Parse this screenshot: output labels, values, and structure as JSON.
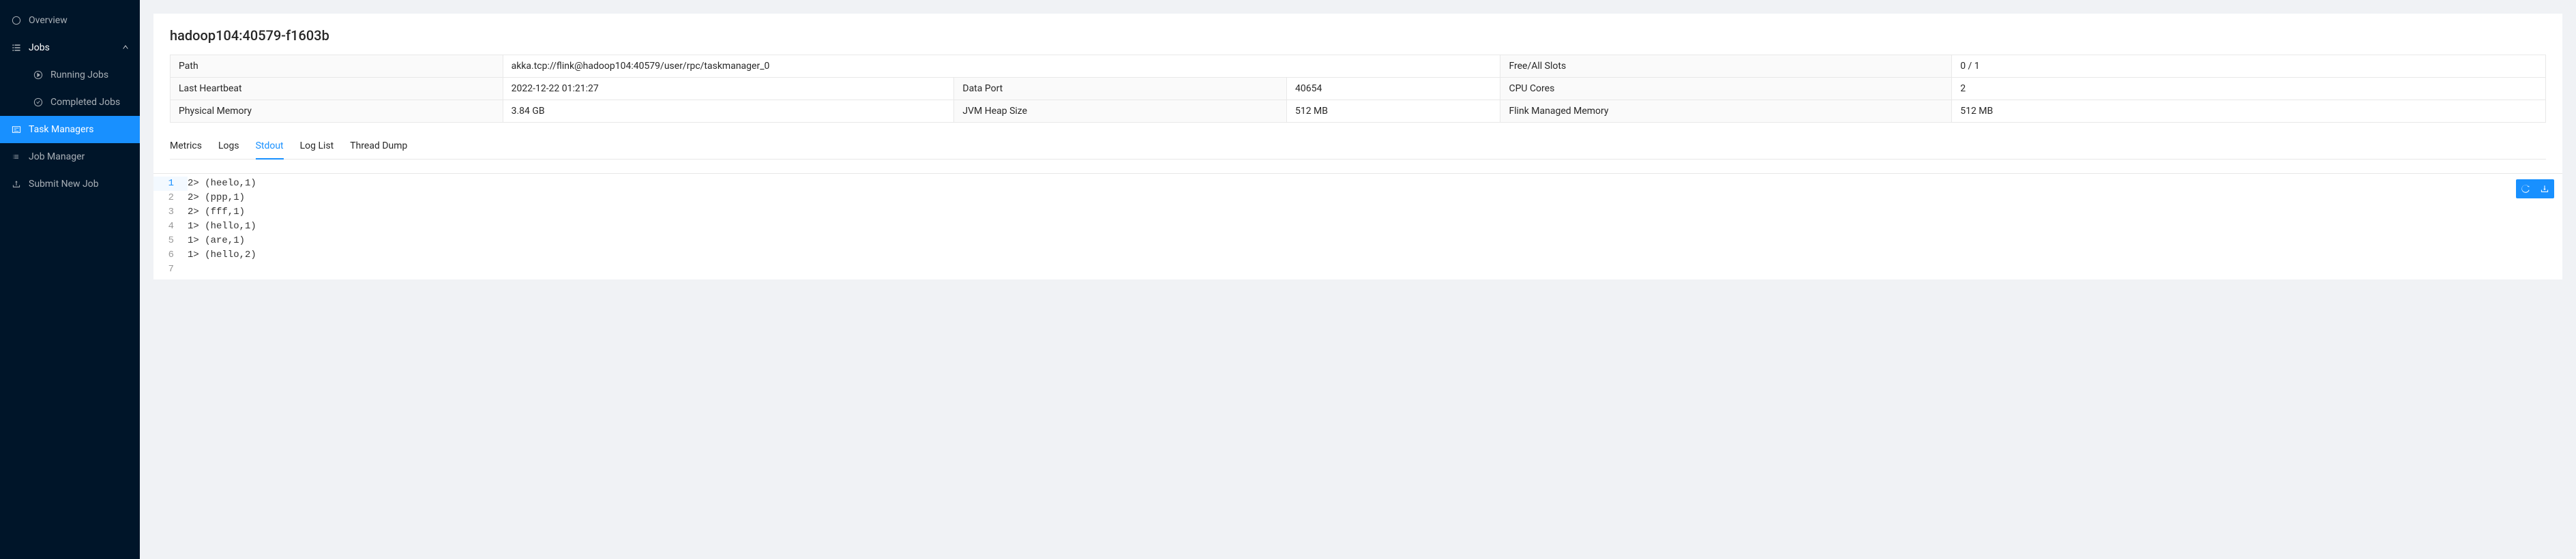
{
  "sidebar": {
    "items": [
      {
        "label": "Overview",
        "icon": "dashboard"
      },
      {
        "label": "Jobs",
        "icon": "list",
        "expanded": true
      },
      {
        "label": "Task Managers",
        "icon": "schedule",
        "active": true
      },
      {
        "label": "Job Manager",
        "icon": "bars"
      },
      {
        "label": "Submit New Job",
        "icon": "upload"
      }
    ],
    "submenu": [
      {
        "label": "Running Jobs",
        "icon": "play-circle"
      },
      {
        "label": "Completed Jobs",
        "icon": "check-circle"
      }
    ]
  },
  "header": {
    "title": "hadoop104:40579-f1603b"
  },
  "info": {
    "path_label": "Path",
    "path_value": "akka.tcp://flink@hadoop104:40579/user/rpc/taskmanager_0",
    "slots_label": "Free/All Slots",
    "slots_value": "0 / 1",
    "heartbeat_label": "Last Heartbeat",
    "heartbeat_value": "2022-12-22 01:21:27",
    "dataport_label": "Data Port",
    "dataport_value": "40654",
    "cpu_label": "CPU Cores",
    "cpu_value": "2",
    "physmem_label": "Physical Memory",
    "physmem_value": "3.84 GB",
    "heap_label": "JVM Heap Size",
    "heap_value": "512 MB",
    "managed_label": "Flink Managed Memory",
    "managed_value": "512 MB"
  },
  "tabs": [
    {
      "label": "Metrics"
    },
    {
      "label": "Logs"
    },
    {
      "label": "Stdout",
      "active": true
    },
    {
      "label": "Log List"
    },
    {
      "label": "Thread Dump"
    }
  ],
  "stdout": {
    "lines": [
      "2> (heelo,1)",
      "2> (ppp,1)",
      "2> (fff,1)",
      "1> (hello,1)",
      "1> (are,1)",
      "1> (hello,2)",
      ""
    ]
  }
}
